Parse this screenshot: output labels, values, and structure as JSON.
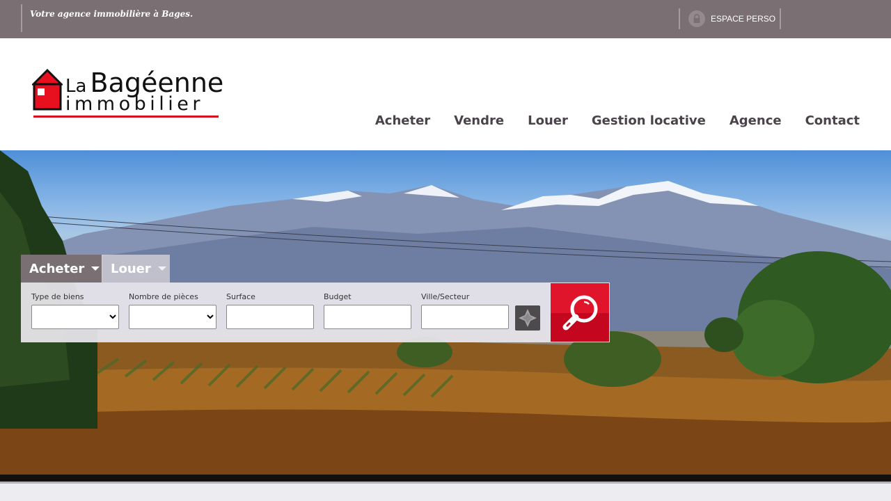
{
  "topbar": {
    "tagline": "Votre agence immobilière à Bages.",
    "espace_perso_label": "ESPACE PERSO"
  },
  "logo": {
    "line1_small": "La",
    "line1_big": "Bagéenne",
    "line2": "immobilier"
  },
  "nav": {
    "items": [
      "Acheter",
      "Vendre",
      "Louer",
      "Gestion locative",
      "Agence",
      "Contact"
    ]
  },
  "search": {
    "tabs": [
      {
        "label": "Acheter"
      },
      {
        "label": "Louer"
      }
    ],
    "fields": {
      "type_biens_label": "Type de biens",
      "nombre_pieces_label": "Nombre de pièces",
      "surface_label": "Surface",
      "budget_label": "Budget",
      "ville_label": "Ville/Secteur"
    }
  },
  "colors": {
    "topbar": "#7a6f72",
    "accent_red": "#d4101f",
    "nav_text": "#4a434a"
  }
}
